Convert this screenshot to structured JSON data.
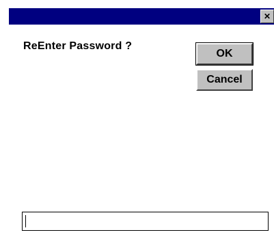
{
  "window": {
    "close_glyph": "✕",
    "title_bar_color": "#000080"
  },
  "dialog": {
    "prompt": "ReEnter Password ?",
    "ok_label": "OK",
    "cancel_label": "Cancel"
  },
  "password_field": {
    "value": "",
    "placeholder": ""
  }
}
